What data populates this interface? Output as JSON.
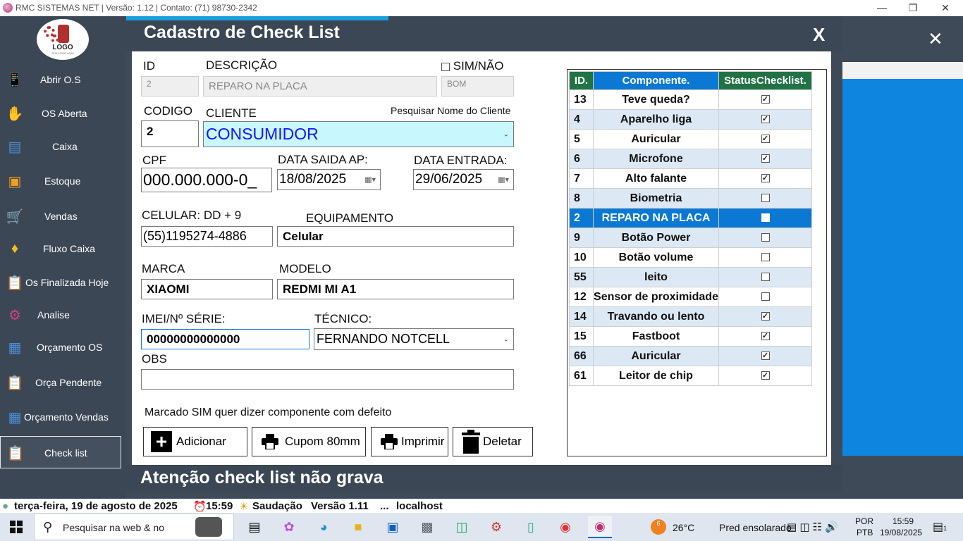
{
  "window": {
    "title": "RMC SISTEMAS NET | Versão: 1.12 | Contato: (71) 98730-2342",
    "minimize": "—",
    "restore": "❐",
    "close": "✕"
  },
  "sidebar": {
    "logo_text": "LOGO",
    "logo_sub": "SUA LOGO AQUI",
    "items": [
      {
        "label": "Abrir O.S",
        "icon": "phone-icon"
      },
      {
        "label": "OS Aberta",
        "icon": "hand-phone-icon"
      },
      {
        "label": "Caixa",
        "icon": "cash-register-icon"
      },
      {
        "label": "Estoque",
        "icon": "box-icon"
      },
      {
        "label": "Vendas",
        "icon": "cart-icon"
      },
      {
        "label": "Fluxo Caixa",
        "icon": "cash-flow-icon"
      },
      {
        "label": "Os Finalizada Hoje",
        "icon": "clipboard-phone-icon"
      },
      {
        "label": "Analise",
        "icon": "analysis-icon"
      },
      {
        "label": "Orçamento OS",
        "icon": "budget-icon"
      },
      {
        "label": "Orça Pendente",
        "icon": "clipboard-icon"
      },
      {
        "label": "Orçamento Vendas",
        "icon": "calculator-icon"
      },
      {
        "label": "Check list",
        "icon": "checklist-icon"
      }
    ]
  },
  "modal": {
    "title": "Cadastro de Check List",
    "close": "X",
    "outer_close": "✕",
    "footer": "Atenção check list não grava"
  },
  "form": {
    "id_label": "ID",
    "id_value": "2",
    "descricao_label": "DESCRIÇÃO",
    "descricao_value": "REPARO NA PLACA",
    "simnao_label": "SIM/NÃO",
    "simnao_value": "BOM",
    "codigo_label": "CODIGO",
    "codigo_value": "2",
    "cliente_label": "CLIENTE",
    "pesquisar_label": "Pesquisar Nome do Cliente",
    "cliente_value": "CONSUMIDOR",
    "cpf_label": "CPF",
    "cpf_value": "000.000.000-0_",
    "data_saida_label": "DATA SAIDA AP:",
    "data_saida_value": "18/08/2025",
    "data_entrada_label": "DATA ENTRADA:",
    "data_entrada_value": "29/06/2025",
    "celular_label": "CELULAR: DD + 9",
    "celular_value": "(55)1195274-4886",
    "equipamento_label": "EQUIPAMENTO",
    "equipamento_value": "Celular",
    "marca_label": "MARCA",
    "marca_value": "XIAOMI",
    "modelo_label": "MODELO",
    "modelo_value": "REDMI MI A1",
    "imei_label": "IMEI/Nº SÉRIE:",
    "imei_value": "00000000000000",
    "tecnico_label": "TÉCNICO:",
    "tecnico_value": "FERNANDO NOTCELL",
    "obs_label": "OBS",
    "obs_value": "",
    "hint": "Marcado SIM quer dizer componente com defeito"
  },
  "buttons": {
    "adicionar": "Adicionar",
    "cupom": "Cupom 80mm",
    "imprimir": "Imprimir",
    "deletar": "Deletar"
  },
  "checklist": {
    "headers": [
      "ID.",
      "Componente.",
      "StatusChecklist."
    ],
    "header_colors": [
      "#217346",
      "#0b78d4",
      "#217346"
    ],
    "selected_color": "#0b78d4",
    "rows": [
      {
        "id": "13",
        "component": "Teve queda?",
        "checked": true
      },
      {
        "id": "4",
        "component": "Aparelho liga",
        "checked": true
      },
      {
        "id": "5",
        "component": "Auricular",
        "checked": true
      },
      {
        "id": "6",
        "component": "Microfone",
        "checked": true
      },
      {
        "id": "7",
        "component": "Alto falante",
        "checked": true
      },
      {
        "id": "8",
        "component": "Biometria",
        "checked": false
      },
      {
        "id": "2",
        "component": "REPARO NA PLACA",
        "checked": false,
        "selected": true
      },
      {
        "id": "9",
        "component": "Botão Power",
        "checked": false
      },
      {
        "id": "10",
        "component": "Botão volume",
        "checked": false
      },
      {
        "id": "55",
        "component": "leito",
        "checked": false
      },
      {
        "id": "12",
        "component": "Sensor de proximidade",
        "checked": false
      },
      {
        "id": "14",
        "component": "Travando ou lento",
        "checked": true
      },
      {
        "id": "15",
        "component": "Fastboot",
        "checked": true
      },
      {
        "id": "66",
        "component": "Auricular",
        "checked": true
      },
      {
        "id": "61",
        "component": "Leitor de chip",
        "checked": true
      }
    ]
  },
  "statusbar": {
    "date": "terça-feira, 19 de agosto de 2025",
    "time": "15:59",
    "greeting": "Saudação",
    "version": "Versão 1.11",
    "ellipsis": "...",
    "host": "localhost"
  },
  "taskbar": {
    "search_placeholder": "Pesquisar na web & no",
    "weather_badge": "6",
    "temperature": "26°C",
    "weather": "Pred ensolarado",
    "lang1": "POR",
    "lang2": "PTB",
    "clock_time": "15:59",
    "clock_date": "19/08/2025",
    "notif_count": "1"
  }
}
